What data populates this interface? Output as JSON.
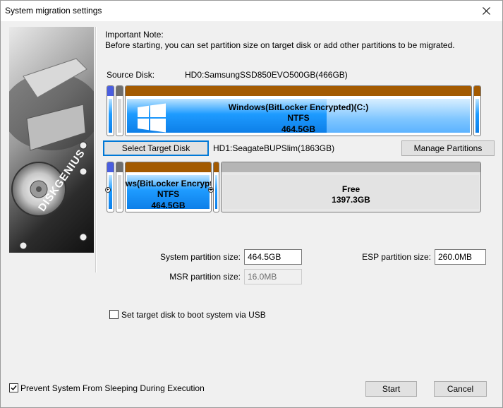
{
  "window": {
    "title": "System migration settings"
  },
  "note": {
    "title": "Important Note:",
    "text": "Before starting, you can set partition size on target disk or add other partitions to be migrated."
  },
  "source": {
    "label": "Source Disk:",
    "value": "HD0:SamsungSSD850EVO500GB(466GB)",
    "main_partition": {
      "name": "Windows(BitLocker Encrypted)(C:)",
      "fs": "NTFS",
      "size": "464.5GB"
    }
  },
  "target": {
    "select_button": "Select Target Disk",
    "value": "HD1:SeagateBUPSlim(1863GB)",
    "manage_button": "Manage Partitions",
    "main_partition": {
      "name": "ws(BitLocker Encrypt",
      "fs": "NTFS",
      "size": "464.5GB"
    },
    "free_partition": {
      "name": "Free",
      "size": "1397.3GB"
    }
  },
  "sizes": {
    "system_label": "System partition size:",
    "system_value": "464.5GB",
    "esp_label": "ESP partition size:",
    "esp_value": "260.0MB",
    "msr_label": "MSR partition size:",
    "msr_value": "16.0MB"
  },
  "options": {
    "usb_boot": "Set target disk to boot system via USB",
    "prevent_sleep": "Prevent System From Sleeping During Execution"
  },
  "buttons": {
    "start": "Start",
    "cancel": "Cancel"
  },
  "logo_text": "DISKGENIUS"
}
